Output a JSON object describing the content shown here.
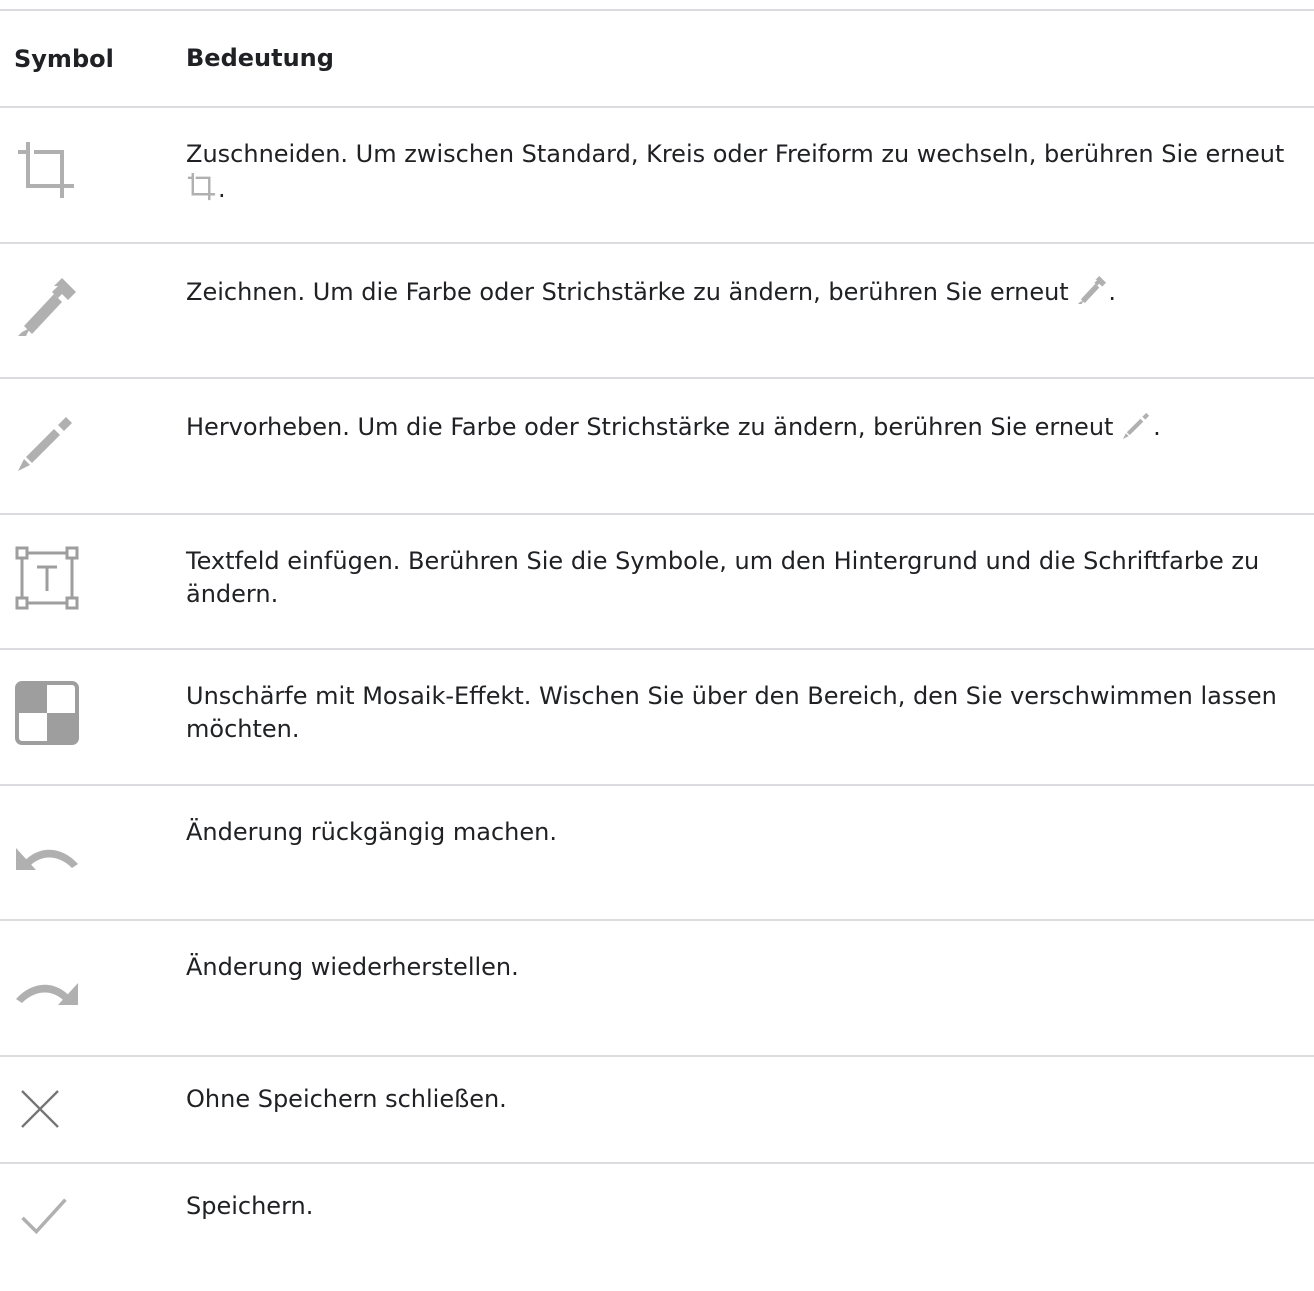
{
  "header": {
    "symbol_col": "Symbol",
    "meaning_col": "Bedeutung"
  },
  "rows": [
    {
      "icon": "crop-icon",
      "text_before": "Zuschneiden. Um zwischen Standard, Kreis oder Freiform zu wechseln, berühren Sie erneut ",
      "text_after": "."
    },
    {
      "icon": "pen-icon",
      "text_before": "Zeichnen. Um die Farbe oder Strichstärke zu ändern, berühren Sie erneut ",
      "text_after": "."
    },
    {
      "icon": "highlighter-icon",
      "text_before": "Hervorheben. Um die Farbe oder Strichstärke zu ändern, berühren Sie erneut ",
      "text_after": "."
    },
    {
      "icon": "text-box-icon",
      "text": "Textfeld einfügen. Berühren Sie die Symbole, um den Hintergrund und die Schriftfarbe zu ändern."
    },
    {
      "icon": "mosaic-blur-icon",
      "text": "Unschärfe mit Mosaik-Effekt. Wischen Sie über den Bereich, den Sie verschwimmen lassen möchten."
    },
    {
      "icon": "undo-icon",
      "text": "Änderung rückgängig machen."
    },
    {
      "icon": "redo-icon",
      "text": "Änderung wiederherstellen."
    },
    {
      "icon": "close-icon",
      "text": "Ohne Speichern schließen."
    },
    {
      "icon": "check-icon",
      "text": "Speichern."
    }
  ],
  "colors": {
    "icon_gray": "#b0b0b0",
    "icon_dark_gray": "#757575",
    "rule": "#dadce0",
    "text": "#202124"
  }
}
